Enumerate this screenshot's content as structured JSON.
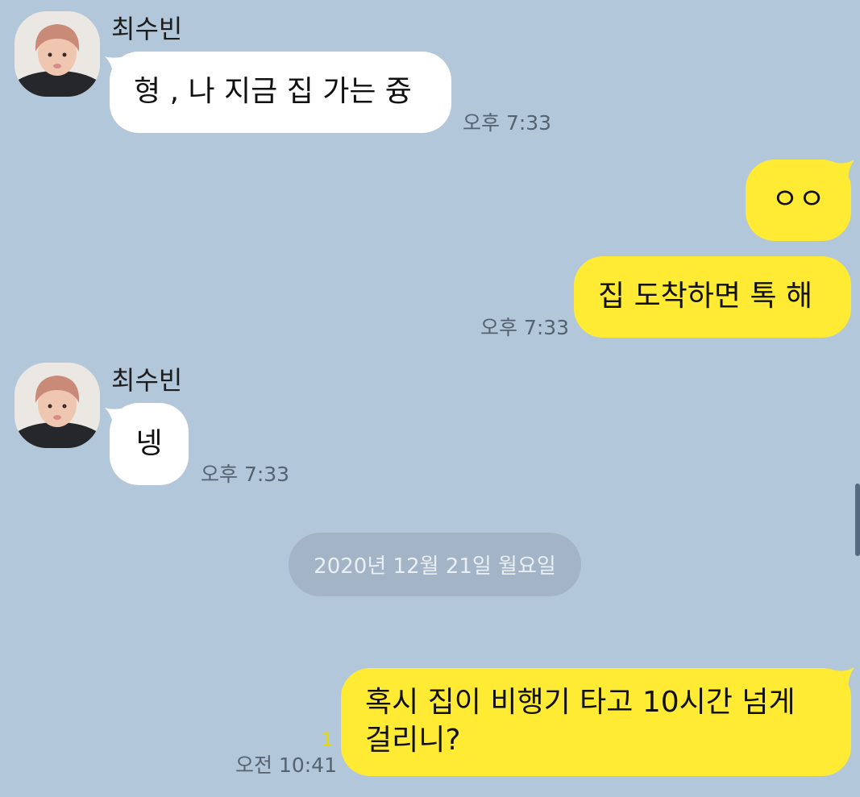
{
  "messages": [
    {
      "sender": "최수빈",
      "text": "형 , 나 지금 집 가는 즁",
      "time": "오후 7:33"
    },
    {
      "text": "ㅇㅇ"
    },
    {
      "text": "집 도착하면 톡 해",
      "time": "오후 7:33"
    },
    {
      "sender": "최수빈",
      "text": "넹",
      "time": "오후 7:33"
    },
    {
      "text": "혹시 집이 비행기 타고 10시간 넘게 걸리니?",
      "time": "오전 10:41",
      "unread": "1"
    }
  ],
  "date_divider": "2020년 12월 21일 월요일",
  "colors": {
    "background": "#b2c7da",
    "bubble_incoming": "#ffffff",
    "bubble_outgoing": "#ffeb33",
    "date_pill": "#a2b4c5",
    "unread_count": "#e8d600"
  }
}
